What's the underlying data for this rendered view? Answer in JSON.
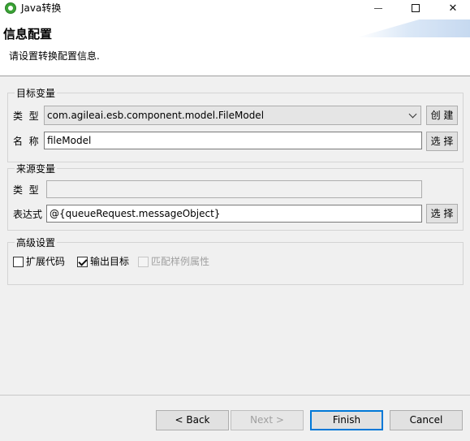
{
  "window": {
    "title": "Java转换",
    "minimize": "—",
    "maximize": "☐",
    "close": "✕"
  },
  "header": {
    "title": "信息配置",
    "description": "请设置转换配置信息."
  },
  "target": {
    "label": "目标变量",
    "type_label": "类  型",
    "type_value": "com.agileai.esb.component.model.FileModel",
    "create_button": "创 建",
    "name_label": "名  称",
    "name_value": "fileModel",
    "select_button": "选 择"
  },
  "source": {
    "label": "来源变量",
    "type_label": "类  型",
    "type_value": "",
    "expr_label": "表达式",
    "expr_value": "@{queueRequest.messageObject}",
    "select_button": "选 择"
  },
  "advanced": {
    "label": "高级设置",
    "options": [
      {
        "label": "扩展代码",
        "checked": false,
        "enabled": true
      },
      {
        "label": "输出目标",
        "checked": true,
        "enabled": true
      },
      {
        "label": "匹配样例属性",
        "checked": false,
        "enabled": false
      }
    ]
  },
  "footer": {
    "back": "< Back",
    "next": "Next >",
    "finish": "Finish",
    "cancel": "Cancel"
  }
}
